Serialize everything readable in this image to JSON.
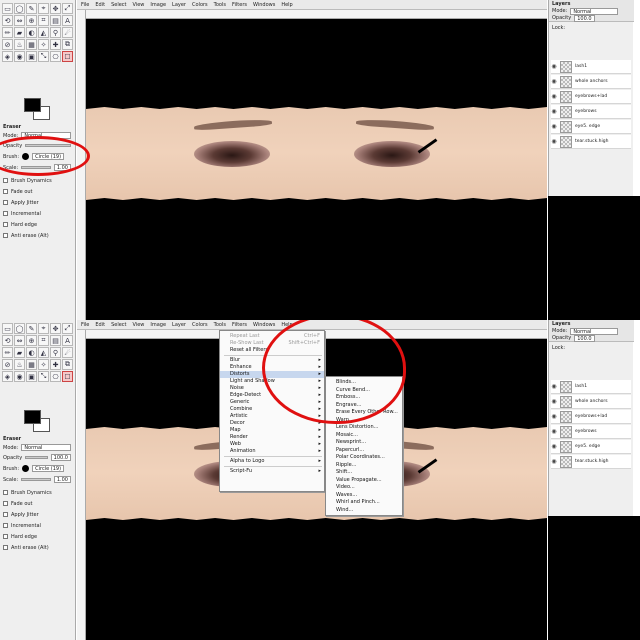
{
  "menubar": [
    "File",
    "Edit",
    "Select",
    "View",
    "Image",
    "Layer",
    "Colors",
    "Tools",
    "Filters",
    "Windows",
    "Help"
  ],
  "tool_options": {
    "title": "Eraser",
    "mode_label": "Mode:",
    "mode_value": "Normal",
    "opacity_label": "Opacity",
    "opacity_value": "100.0",
    "brush_label": "Brush:",
    "brush_value": "Circle (19)",
    "scale_label": "Scale:",
    "scale_value": "1.00",
    "checkboxes": [
      "Brush Dynamics",
      "Fade out",
      "Apply Jitter",
      "Incremental",
      "Hard edge",
      "Anti erase (Alt)"
    ]
  },
  "layers_panel": {
    "title": "Layers",
    "mode_label": "Mode:",
    "mode_value": "Normal",
    "opacity_label": "Opacity",
    "opacity_value": "100.0",
    "lock_label": "Lock:",
    "layers": [
      "lash1",
      "whole anchors",
      "eyebrows+lad",
      "eyebrows",
      "eye5. edge",
      "tear.stuck.high"
    ]
  },
  "filters_menu": {
    "items": [
      {
        "label": "Repeat Last",
        "shortcut": "Ctrl+F",
        "disabled": true
      },
      {
        "label": "Re-Show Last",
        "shortcut": "Shift+Ctrl+F",
        "disabled": true
      },
      {
        "label": "Reset all Filters"
      },
      {
        "sep": true
      },
      {
        "label": "Blur",
        "sub": true
      },
      {
        "label": "Enhance",
        "sub": true
      },
      {
        "label": "Distorts",
        "sub": true,
        "highlight": true
      },
      {
        "label": "Light and Shadow",
        "sub": true
      },
      {
        "label": "Noise",
        "sub": true
      },
      {
        "label": "Edge-Detect",
        "sub": true
      },
      {
        "label": "Generic",
        "sub": true
      },
      {
        "label": "Combine",
        "sub": true
      },
      {
        "label": "Artistic",
        "sub": true
      },
      {
        "label": "Decor",
        "sub": true
      },
      {
        "label": "Map",
        "sub": true
      },
      {
        "label": "Render",
        "sub": true
      },
      {
        "label": "Web",
        "sub": true
      },
      {
        "label": "Animation",
        "sub": true
      },
      {
        "sep": true
      },
      {
        "label": "Alpha to Logo",
        "sub": true
      },
      {
        "sep": true
      },
      {
        "label": "Script-Fu",
        "sub": true
      }
    ]
  },
  "distorts_menu": {
    "items": [
      "Blinds...",
      "Curve Bend...",
      "Emboss...",
      "Engrave...",
      "Erase Every Other Row...",
      "Warp...",
      "Lens Distortion...",
      "Mosaic...",
      "Newsprint...",
      "Papercurl...",
      "Polar Coordinates...",
      "Ripple...",
      "Shift...",
      "Value Propagate...",
      "Video...",
      "Waves...",
      "Whirl and Pinch...",
      "Wind..."
    ]
  }
}
